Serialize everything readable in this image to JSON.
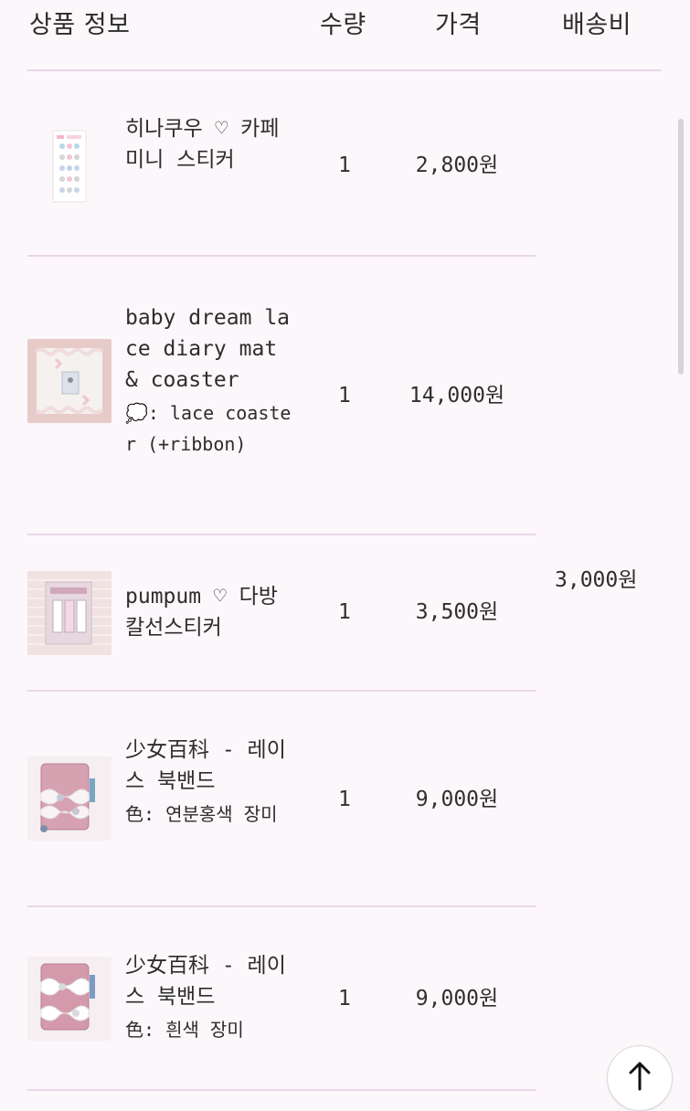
{
  "header": {
    "product_info": "상품 정보",
    "quantity": "수량",
    "price": "가격",
    "shipping": "배송비"
  },
  "items": [
    {
      "name": "히나쿠우 ♡ 카페 미니 스티커",
      "option": "",
      "quantity": "1",
      "price": "2,800원"
    },
    {
      "name": "baby dream lace diary mat & coaster",
      "option": "💭: lace coaster (+ribbon)",
      "quantity": "1",
      "price": "14,000원"
    },
    {
      "name": "pumpum ♡ 다방 칼선스티커",
      "option": "",
      "quantity": "1",
      "price": "3,500원"
    },
    {
      "name": "少女百科 - 레이스 북밴드",
      "option": "色: 연분홍색 장미",
      "quantity": "1",
      "price": "9,000원"
    },
    {
      "name": "少女百科 - 레이스 북밴드",
      "option": "色: 흰색 장미",
      "quantity": "1",
      "price": "9,000원"
    }
  ],
  "shipping_fee": "3,000원",
  "icons": {
    "scroll_top": "arrow-up-icon"
  },
  "colors": {
    "background": "#fcf7fa",
    "divider": "#ead6e8",
    "text": "#2d2d2d"
  }
}
